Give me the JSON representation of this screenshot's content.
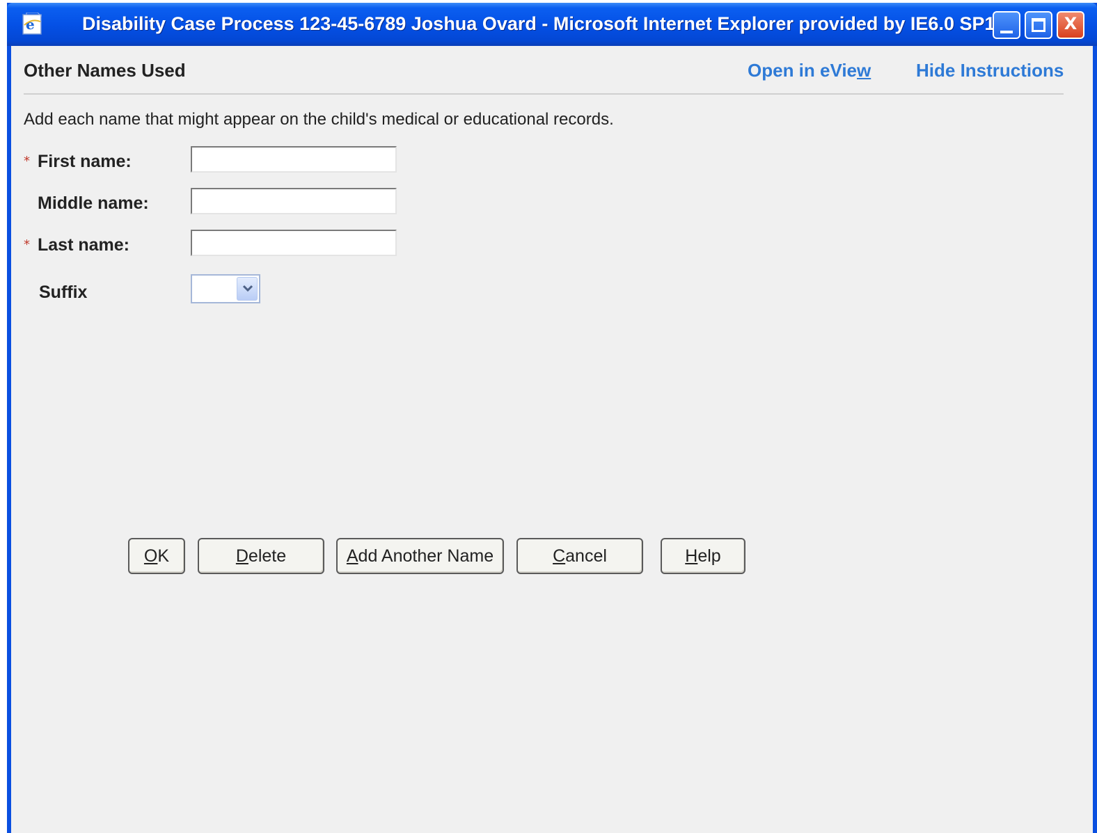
{
  "window": {
    "title": "Disability Case Process 123-45-6789 Joshua Ovard  -  Microsoft Internet Explorer provided by IE6.0 SP1...",
    "controls": {
      "minimize_icon": "minimize-icon",
      "maximize_icon": "maximize-icon",
      "close_icon": "close-icon",
      "close_glyph": "X"
    },
    "colors": {
      "titlebar": "#0551e6",
      "close_button": "#d8401e",
      "link": "#2e7ad6",
      "background": "#f0f0f0"
    }
  },
  "header": {
    "title": "Other Names Used",
    "links": {
      "open_eview_prefix": "Open in eVie",
      "open_eview_accel": "w",
      "hide_instructions": "Hide Instructions"
    }
  },
  "instructions": "Add each name that might appear on the child's medical or educational records.",
  "form": {
    "required_marker": "*",
    "first_name": {
      "label": "First name:",
      "value": "",
      "required": true
    },
    "middle_name": {
      "label": "Middle name:",
      "value": "",
      "required": false
    },
    "last_name": {
      "label": "Last name:",
      "value": "",
      "required": true
    },
    "suffix": {
      "label": "Suffix",
      "selected": ""
    }
  },
  "buttons": {
    "ok": {
      "accel": "O",
      "rest": "K"
    },
    "delete": {
      "accel": "D",
      "rest": "elete"
    },
    "add_another": {
      "accel": "A",
      "rest": "dd Another Name"
    },
    "cancel": {
      "accel": "C",
      "rest": "ancel"
    },
    "help": {
      "accel": "H",
      "rest": "elp"
    }
  }
}
